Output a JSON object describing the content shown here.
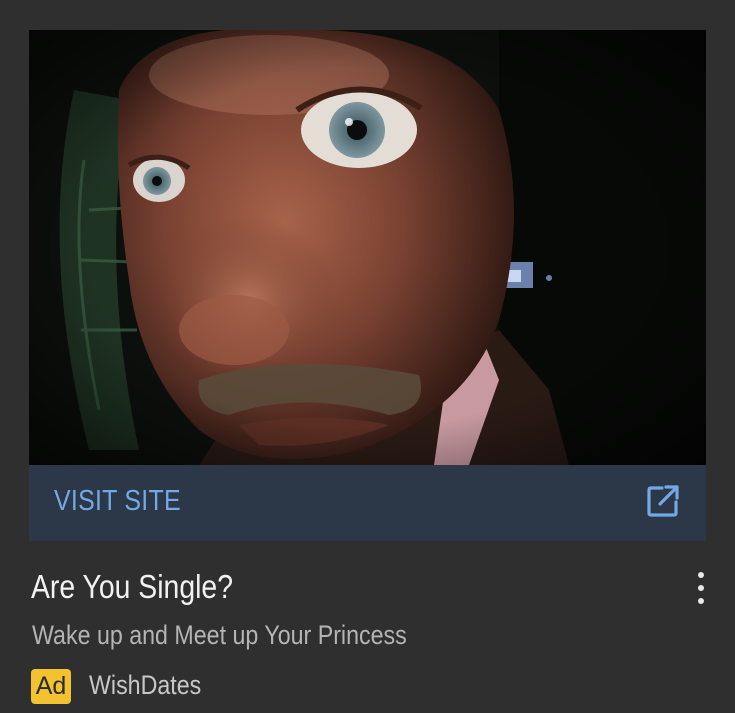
{
  "ad": {
    "media": {
      "description_icon": "photo-close-up-face"
    },
    "cta": {
      "label": "VISIT SITE",
      "icon": "open-in-new-icon"
    },
    "headline": "Are You Single?",
    "body": "Wake up and Meet up Your Princess",
    "badge": "Ad",
    "advertiser": "WishDates",
    "menu_icon": "more-vert-icon"
  },
  "colors": {
    "background": "#2f2f2f",
    "cta_bar": "#2c3748",
    "cta_text": "#73a9e6",
    "badge": "#f2c230",
    "headline": "#f2f2f2",
    "body": "#b4b4b4"
  }
}
